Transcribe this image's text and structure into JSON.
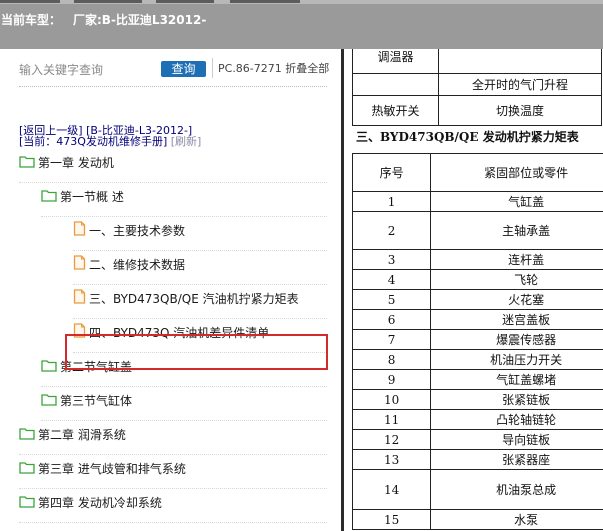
{
  "header": {
    "car_label": "当前车型：",
    "car_value": "厂家:B-比亚迪L32012-"
  },
  "search": {
    "placeholder": "输入关键字查询",
    "button": "查询",
    "pc_code": "PC.86-7271 折叠全部"
  },
  "nav": {
    "back": "[返回上一级] [B-比亚迪-L3-2012-]",
    "current_prefix": "[当前：473Q发动机维修手册]",
    "refresh": "[刷新]"
  },
  "tree": [
    {
      "label": "第一章 发动机",
      "icon": "folder-icon"
    },
    {
      "label": "第一节概 述",
      "icon": "folder-icon"
    },
    {
      "label": "一、主要技术参数",
      "icon": "document-icon"
    },
    {
      "label": "二、维修技术数据",
      "icon": "document-icon"
    },
    {
      "label": "三、BYD473QB/QE 汽油机拧紧力矩表",
      "icon": "document-icon",
      "highlighted": true
    },
    {
      "label": "四、BYD473Q 汽油机差异件清单",
      "icon": "document-icon"
    },
    {
      "label": "第二节气缸盖",
      "icon": "folder-icon"
    },
    {
      "label": "第三节气缸体",
      "icon": "folder-icon"
    },
    {
      "label": "第二章 润滑系统",
      "icon": "folder-icon"
    },
    {
      "label": "第三章 进气歧管和排气系统",
      "icon": "folder-icon"
    },
    {
      "label": "第四章 发动机冷却系统",
      "icon": "folder-icon"
    }
  ],
  "doc": {
    "top_rows": [
      {
        "c1": "调温器",
        "c2": ""
      },
      {
        "c1": "",
        "c2": "全开时的气门升程"
      },
      {
        "c1": "热敏开关",
        "c2": "切换温度"
      }
    ],
    "section_title": "三、BYD473QB/QE 发动机拧紧力矩表",
    "header": [
      "序号",
      "紧固部位或零件"
    ],
    "rows": [
      [
        "1",
        "气缸盖"
      ],
      [
        "2",
        "主轴承盖"
      ],
      [
        "3",
        "连杆盖"
      ],
      [
        "4",
        "飞轮"
      ],
      [
        "5",
        "火花塞"
      ],
      [
        "6",
        "迷宫盖板"
      ],
      [
        "7",
        "爆震传感器"
      ],
      [
        "8",
        "机油压力开关"
      ],
      [
        "9",
        "气缸盖螺堵"
      ],
      [
        "10",
        "张紧链板"
      ],
      [
        "11",
        "凸轮轴链轮"
      ],
      [
        "12",
        "导向链板"
      ],
      [
        "13",
        "张紧器座"
      ],
      [
        "14",
        "机油泵总成"
      ],
      [
        "15",
        "水泵"
      ]
    ]
  },
  "colors": {
    "header_bg": "#9a9a9a",
    "search_btn": "#1f6fb5",
    "link": "#00007a",
    "highlight": "#d42a2a",
    "folder": "#3aa33a",
    "document": "#e89a3c"
  }
}
